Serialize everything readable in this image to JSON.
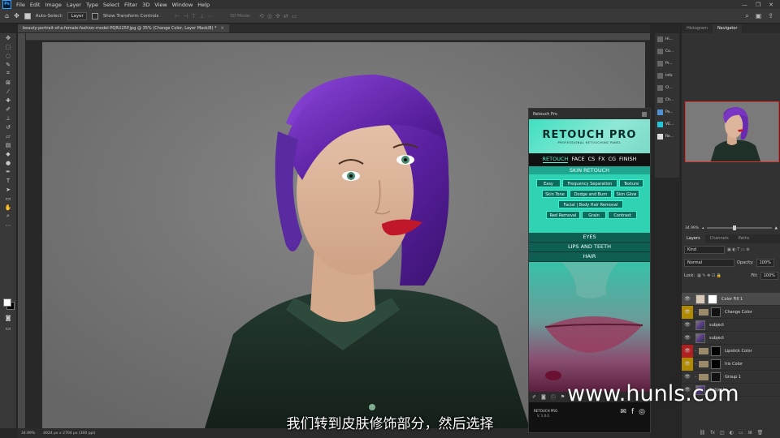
{
  "app": {
    "logo": "Ps"
  },
  "menu": [
    "File",
    "Edit",
    "Image",
    "Layer",
    "Type",
    "Select",
    "Filter",
    "3D",
    "View",
    "Window",
    "Help"
  ],
  "window_controls": [
    "—",
    "❐",
    "✕"
  ],
  "options": {
    "auto_select_label": "Auto-Select:",
    "auto_select_target": "Layer",
    "transform_controls_label": "Show Transform Controls",
    "mode_3d_label": "3D Mode:"
  },
  "document": {
    "tab_title": "beauty-portrait-of-a-female-fashion-model-PQRU25P.jpg @ 35% (Change Color, Layer Mask/8) *",
    "close": "×"
  },
  "status": {
    "zoom": "34.99%",
    "doc_info": "4024 px x 2704 px (300 ppi)"
  },
  "collapsed_panels": [
    {
      "label": "Hi...",
      "icon": "history-icon"
    },
    {
      "label": "Co...",
      "icon": "color-icon"
    },
    {
      "label": "Pr...",
      "icon": "properties-icon"
    },
    {
      "label": "Info",
      "icon": "info-icon"
    },
    {
      "label": "Cl...",
      "icon": "clone-source-icon"
    },
    {
      "label": "Ch...",
      "icon": "channels-icon"
    },
    {
      "label": "Pa...",
      "icon": "paragraph-icon"
    },
    {
      "label": "VE...",
      "icon": "ve-icon"
    },
    {
      "label": "Re...",
      "icon": "retouch-icon"
    }
  ],
  "right_tabs_top": [
    "Histogram",
    "Navigator"
  ],
  "navigator_zoom": "34.99%",
  "layers_tabs": [
    "Layers",
    "Channels",
    "Paths"
  ],
  "layers_controls": {
    "filter": "Kind",
    "blend_mode": "Normal",
    "opacity_label": "Opacity:",
    "opacity_value": "100%",
    "lock_label": "Lock:",
    "fill_label": "Fill:",
    "fill_value": "100%"
  },
  "layers": [
    {
      "name": "Color Fill 1",
      "color": "",
      "thumb": "#d8c8b8",
      "mask": "#ffffff",
      "selected": true,
      "group": false
    },
    {
      "name": "Change Color",
      "color": "#b08a00",
      "thumb": "folder",
      "mask": "#111111",
      "selected": false,
      "group": true
    },
    {
      "name": "subject",
      "color": "",
      "thumb": "photo",
      "mask": "",
      "selected": false,
      "group": false
    },
    {
      "name": "subject",
      "color": "",
      "thumb": "photo",
      "mask": "",
      "selected": false,
      "group": false
    },
    {
      "name": "Lipstick Color",
      "color": "#b02020",
      "thumb": "folder",
      "mask": "#000000",
      "selected": false,
      "group": true
    },
    {
      "name": "Iris Color",
      "color": "#b08a00",
      "thumb": "folder",
      "mask": "#000000",
      "selected": false,
      "group": true
    },
    {
      "name": "Group 1",
      "color": "",
      "thumb": "folder",
      "mask": "#111111",
      "selected": false,
      "group": true
    },
    {
      "name": "Subject",
      "color": "",
      "thumb": "photo",
      "mask": "",
      "selected": false,
      "group": false
    }
  ],
  "retouch_pro": {
    "panel_title": "Retouch Pro",
    "logo": "RETOUCH PRO",
    "tagline": "PROFESSIONAL RETOUCHING PANEL",
    "tabs": [
      "RETOUCH",
      "FACE",
      "CS",
      "FX",
      "CG",
      "FINISH"
    ],
    "skin_title": "SKIN RETOUCH",
    "skin_buttons": {
      "easy": "Easy",
      "freq_sep": "Frequency Separation",
      "texture": "Texture",
      "skin_tone": "Skin Tone",
      "dodge_burn": "Dodge and Burn",
      "skin_glow": "Skin Glow",
      "facial_hair": "Facial | Body Hair Removal",
      "red_removal": "Red Removal",
      "grain": "Grain",
      "contrast": "Contrast"
    },
    "sections": [
      "EYES",
      "LIPS AND TEETH",
      "HAIR"
    ],
    "footer_name": "RETOUCH PRO",
    "footer_version": "V. 1.0.0"
  },
  "subtitle": "我们转到皮肤修饰部分，然后选择",
  "watermark": "www.hunls.com",
  "colors": {
    "hair": "#6a2bb0",
    "accent": "#31a8ff",
    "retouch_accent": "#2fd3b4"
  }
}
